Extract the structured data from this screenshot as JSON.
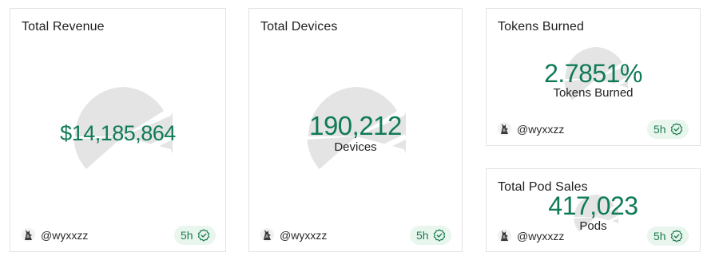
{
  "cards": {
    "revenue": {
      "title": "Total Revenue",
      "value": "$14,185,864",
      "author": "@wyxxzz",
      "age": "5h",
      "avatar_icon": "wolf-avatar-icon",
      "badge_icon": "verified-check-icon"
    },
    "devices": {
      "title": "Total Devices",
      "value": "190,212",
      "unit": "Devices",
      "author": "@wyxxzz",
      "age": "5h",
      "avatar_icon": "wolf-avatar-icon",
      "badge_icon": "verified-check-icon"
    },
    "tokens": {
      "title": "Tokens Burned",
      "value": "2.7851%",
      "unit": "Tokens Burned",
      "author": "@wyxxzz",
      "age": "5h",
      "avatar_icon": "wolf-avatar-icon",
      "badge_icon": "verified-check-icon"
    },
    "pods": {
      "title": "Total Pod Sales",
      "value": "417,023",
      "unit": "Pods",
      "author": "@wyxxzz",
      "age": "5h",
      "avatar_icon": "wolf-avatar-icon",
      "badge_icon": "verified-check-icon"
    }
  },
  "colors": {
    "value_green": "#0f7b55",
    "badge_bg": "#e8f6ee",
    "decor_grey": "#e4e4e4",
    "card_border": "#e3e3e3"
  }
}
